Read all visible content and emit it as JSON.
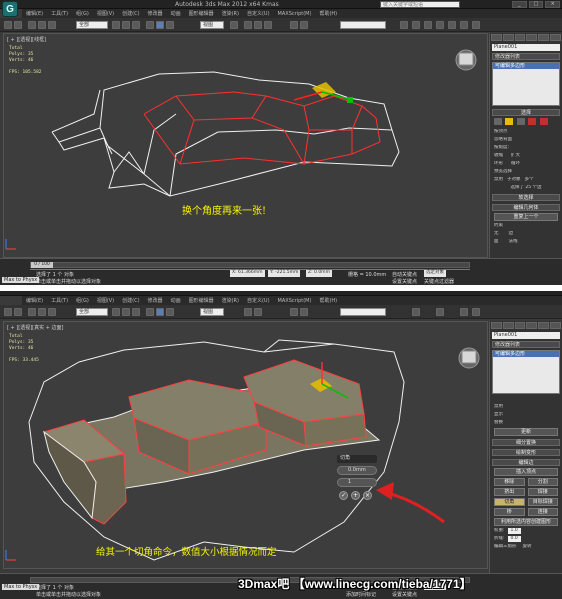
{
  "screenshot1": {
    "window_title": "Autodesk 3ds Max  2012 x64     Kmas",
    "search_placeholder": "键入关键字或短语",
    "menu": [
      "编辑(E)",
      "工具(T)",
      "组(G)",
      "视图(V)",
      "创建(C)",
      "修改器",
      "动画",
      "图形编辑器",
      "渲染(R)",
      "自定义(U)",
      "MAXScript(M)",
      "帮助(H)"
    ],
    "selection_filter": "全部",
    "view_dropdown": "视图",
    "viewport_label": "[ + ][透视][线框]",
    "stats": {
      "total": "Total",
      "polys": "Polys: 35",
      "verts": "Verts: 46",
      "fps": "FPS:  105.582"
    },
    "caption": "换个角度再来一张!",
    "panel": {
      "object_name": "Plane001",
      "modifier_list": "修改器列表",
      "stack_item": "可编辑多边形",
      "rollout_selection": "选择",
      "by_vertex": "按顶点",
      "ignore_backfacing": "忽略背面",
      "by_angle": "按角度:",
      "shrink": "收缩",
      "grow": "扩大",
      "ring": "环形",
      "loop": "循环",
      "preview_selection": "预览选择",
      "disabled": "禁用",
      "subobj": "子对象",
      "multi": "多个",
      "selected_count": "选择了 25 个边",
      "rollout_soft": "软选择",
      "rollout_edit_geometry": "编辑几何体",
      "repeat_last": "重复上一个",
      "constraints": "约束",
      "none": "无",
      "edge": "边",
      "face": "面",
      "normal": "法线"
    },
    "frame": "0 / 100",
    "status_selected": "选择了 1 个 对象",
    "status_hint": "单击或单击并拖动以选择对象",
    "maxscript": "Max to Physx",
    "coord_x": "X: 61.366mm",
    "coord_y": "Y: -221.5mm",
    "coord_z": "Z: 0.0mm",
    "grid": "栅格 = 10.0mm",
    "autokey": "自动关键点",
    "setkey": "设置关键点",
    "key_filter": "选定对象",
    "key_filters_btn": "关键点过滤器"
  },
  "screenshot2": {
    "viewport_label": "[ + ][透视][真实 + 边面]",
    "stats": {
      "total": "Total",
      "polys": "Polys: 35",
      "verts": "Verts: 46",
      "fps": "FPS:   33.445"
    },
    "caption": "给其一个切角命令，数值大小根据情况而定",
    "bevel": {
      "title": "切角",
      "amount": "0.0mm",
      "segments": "1"
    },
    "panel": {
      "object_name": "Plane001",
      "modifier_list": "修改器列表",
      "stack_item": "可编辑多边形",
      "opt1": "禁用",
      "opt2": "显示",
      "opt3": "替换",
      "update": "更新",
      "rollout_paint": "细分置换",
      "rollout_paint2": "绘制变形",
      "rollout_edit_edges": "编辑边",
      "insert_vertex": "插入顶点",
      "remove": "移除",
      "split": "分割",
      "extrude": "挤出",
      "weld": "焊接",
      "chamfer": "切角",
      "target_weld": "目标焊接",
      "bridge": "桥",
      "connect": "连接",
      "create_shape": "利用所选内容创建图形",
      "weight": "权重:",
      "weight_val": "1.0",
      "crease": "折缝:",
      "crease_val": "0.0",
      "edit_tri": "编辑三角形",
      "rotate": "旋转"
    },
    "status_selected": "选择了 1 个 对象",
    "status_hint": "单击或单击并拖动以选择对象",
    "maxscript": "Max to Physx",
    "autokey": "自动关键点",
    "setkey": "设置关键点",
    "key_filter": "选定对象",
    "add_time_tag": "添加时间标记"
  },
  "watermark": "3Dmax吧 【www.linecg.com/tieba/1771】",
  "colors": {
    "caption": "#f4f400",
    "wire": "#ff3030",
    "white_edges": "#f0f0f0",
    "arrow": "#e02020",
    "viewport_bg": "#3d3d3d"
  }
}
